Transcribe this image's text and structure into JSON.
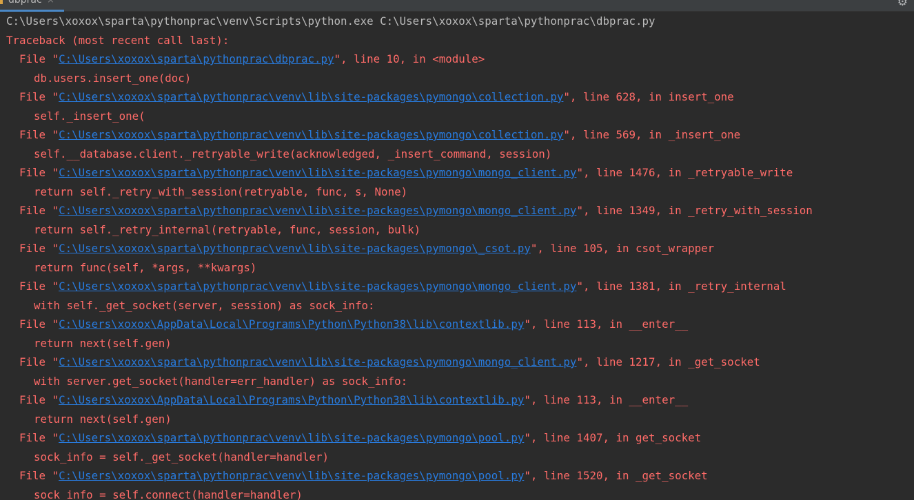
{
  "tab": {
    "title": "dbprac",
    "close": "×"
  },
  "toolbar": {
    "settings_icon": "gear-icon",
    "settings_glyph": "⚙"
  },
  "colors": {
    "error": "#ff6b68",
    "link": "#287bde",
    "command": "#bbbbbb",
    "background": "#2b2b2b"
  },
  "command": "C:\\Users\\xoxox\\sparta\\pythonprac\\venv\\Scripts\\python.exe C:\\Users\\xoxox\\sparta\\pythonprac\\dbprac.py",
  "traceback_header": "Traceback (most recent call last):",
  "frames": [
    {
      "path": "C:\\Users\\xoxox\\sparta\\pythonprac\\dbprac.py",
      "location": ", line 10, in <module>",
      "code": "db.users.insert_one(doc)"
    },
    {
      "path": "C:\\Users\\xoxox\\sparta\\pythonprac\\venv\\lib\\site-packages\\pymongo\\collection.py",
      "location": ", line 628, in insert_one",
      "code": "self._insert_one("
    },
    {
      "path": "C:\\Users\\xoxox\\sparta\\pythonprac\\venv\\lib\\site-packages\\pymongo\\collection.py",
      "location": ", line 569, in _insert_one",
      "code": "self.__database.client._retryable_write(acknowledged, _insert_command, session)"
    },
    {
      "path": "C:\\Users\\xoxox\\sparta\\pythonprac\\venv\\lib\\site-packages\\pymongo\\mongo_client.py",
      "location": ", line 1476, in _retryable_write",
      "code": "return self._retry_with_session(retryable, func, s, None)"
    },
    {
      "path": "C:\\Users\\xoxox\\sparta\\pythonprac\\venv\\lib\\site-packages\\pymongo\\mongo_client.py",
      "location": ", line 1349, in _retry_with_session",
      "code": "return self._retry_internal(retryable, func, session, bulk)"
    },
    {
      "path": "C:\\Users\\xoxox\\sparta\\pythonprac\\venv\\lib\\site-packages\\pymongo\\_csot.py",
      "location": ", line 105, in csot_wrapper",
      "code": "return func(self, *args, **kwargs)"
    },
    {
      "path": "C:\\Users\\xoxox\\sparta\\pythonprac\\venv\\lib\\site-packages\\pymongo\\mongo_client.py",
      "location": ", line 1381, in _retry_internal",
      "code": "with self._get_socket(server, session) as sock_info:"
    },
    {
      "path": "C:\\Users\\xoxox\\AppData\\Local\\Programs\\Python\\Python38\\lib\\contextlib.py",
      "location": ", line 113, in __enter__",
      "code": "return next(self.gen)"
    },
    {
      "path": "C:\\Users\\xoxox\\sparta\\pythonprac\\venv\\lib\\site-packages\\pymongo\\mongo_client.py",
      "location": ", line 1217, in _get_socket",
      "code": "with server.get_socket(handler=err_handler) as sock_info:"
    },
    {
      "path": "C:\\Users\\xoxox\\AppData\\Local\\Programs\\Python\\Python38\\lib\\contextlib.py",
      "location": ", line 113, in __enter__",
      "code": "return next(self.gen)"
    },
    {
      "path": "C:\\Users\\xoxox\\sparta\\pythonprac\\venv\\lib\\site-packages\\pymongo\\pool.py",
      "location": ", line 1407, in get_socket",
      "code": "sock_info = self._get_socket(handler=handler)"
    },
    {
      "path": "C:\\Users\\xoxox\\sparta\\pythonprac\\venv\\lib\\site-packages\\pymongo\\pool.py",
      "location": ", line 1520, in _get_socket",
      "code": "sock_info = self.connect(handler=handler)"
    }
  ]
}
